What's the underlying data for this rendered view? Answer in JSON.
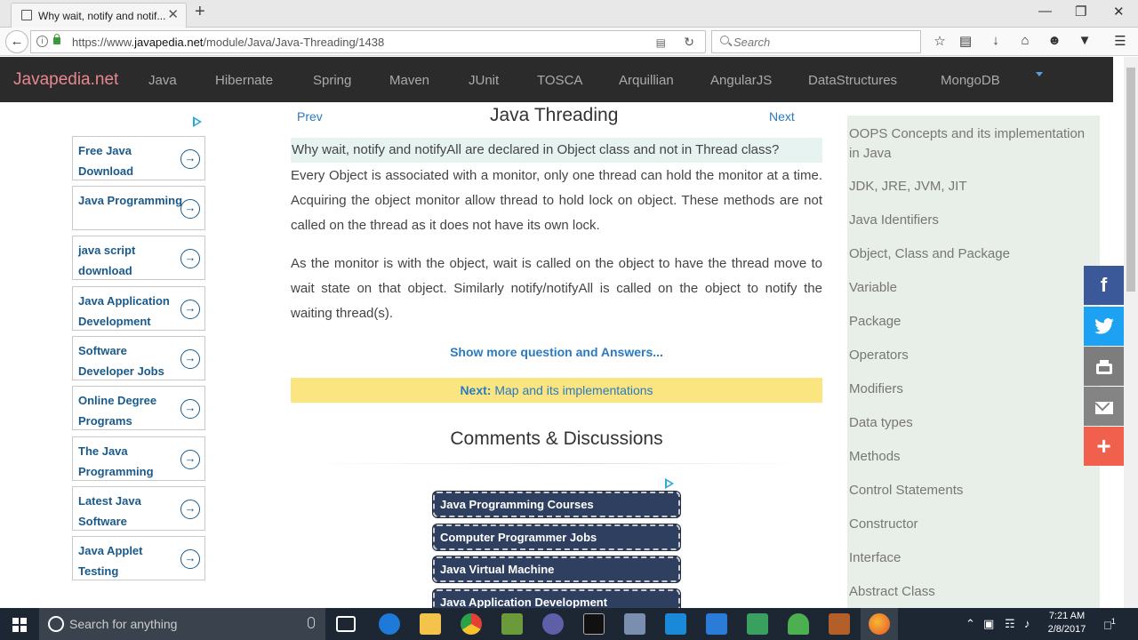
{
  "browser": {
    "tab_title": "Why wait, notify and notif...",
    "tab_close": "✕",
    "new_tab": "+",
    "window_controls": [
      "—",
      "❐",
      "✕"
    ],
    "url_prefix": "https://www.",
    "url_domain": "javapedia.net",
    "url_path": "/module/Java/Java-Threading/1438",
    "search_placeholder": "Search",
    "toolbar_icons": [
      "star-icon",
      "reading-list-icon",
      "download-icon",
      "home-icon",
      "chat-icon",
      "pocket-icon",
      "menu-icon"
    ]
  },
  "site": {
    "logo": "Javapedia.net",
    "nav": [
      "Java",
      "Hibernate",
      "Spring",
      "Maven",
      "JUnit",
      "TOSCA",
      "Arquillian",
      "AngularJS",
      "DataStructures",
      "MongoDB"
    ]
  },
  "left_ads": [
    "Free Java Download",
    "Java Programming",
    "java script download",
    "Java Application Development",
    "Software Developer Jobs",
    "Online Degree Programs",
    "The Java Programming",
    "Latest Java Software",
    "Java Applet Testing"
  ],
  "main": {
    "prev": "Prev",
    "next": "Next",
    "title": "Java Threading",
    "question": "Why wait, notify and notifyAll are declared in Object class and not in Thread class?",
    "para1": "Every Object is associated with a monitor, only one thread can hold the monitor at a time. Acquiring the object monitor allow thread to hold lock on object. These methods are not called on the thread as it does not have its own lock.",
    "para2": "As the monitor is with the object, wait is called on the object to have the thread move to wait state on that object. Similarly notify/notifyAll is called on the object to notify the waiting thread(s).",
    "show_more": "Show more question and Answers...",
    "next_label": "Next:",
    "next_topic": "Map and its implementations",
    "comments_title": "Comments & Discussions",
    "ad_buttons": [
      "Java Programming Courses",
      "Computer Programmer Jobs",
      "Java Virtual Machine",
      "Java Application Development"
    ]
  },
  "right_sidebar": [
    "OOPS Concepts and its implementation in Java",
    "JDK, JRE, JVM, JIT",
    "Java Identifiers",
    "Object, Class and Package",
    "Variable",
    "Package",
    "Operators",
    "Modifiers",
    "Data types",
    "Methods",
    "Control Statements",
    "Constructor",
    "Interface",
    "Abstract Class"
  ],
  "share": {
    "facebook": "f",
    "plus": "+"
  },
  "taskbar": {
    "search_placeholder": "Search for anything",
    "time": "7:21 AM",
    "date": "2/8/2017",
    "notif_count": "1"
  },
  "colors": {
    "logo": "#e9878f",
    "link": "#2a7ac0",
    "header_bg": "#2b2b2b",
    "next_banner": "#fbe581",
    "question_bg": "#e6f3f1",
    "sidebar_bg": "#e8eee8"
  }
}
